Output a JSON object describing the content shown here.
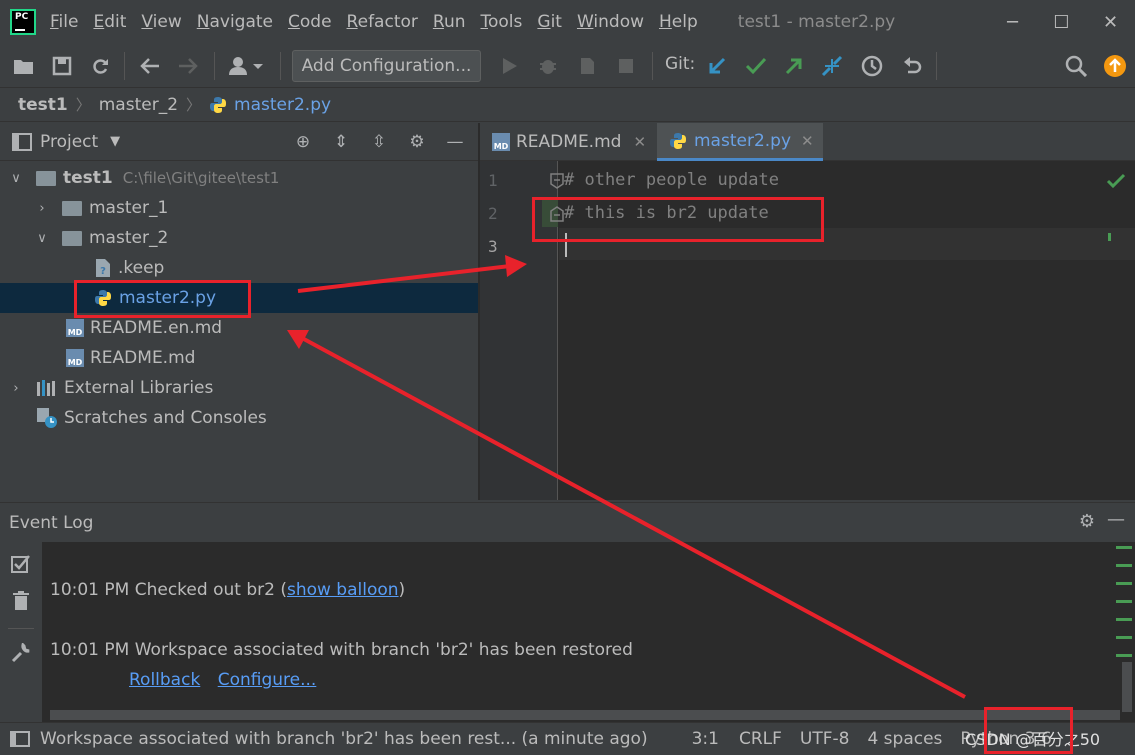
{
  "app": {
    "logo_text": "PC",
    "window_title": "test1 - master2.py"
  },
  "menu": [
    {
      "first": "F",
      "rest": "ile"
    },
    {
      "first": "E",
      "rest": "dit"
    },
    {
      "first": "V",
      "rest": "iew"
    },
    {
      "first": "N",
      "rest": "avigate"
    },
    {
      "first": "C",
      "rest": "ode"
    },
    {
      "first": "R",
      "rest": "efactor"
    },
    {
      "first": "R",
      "rest": "un"
    },
    {
      "first": "T",
      "rest": "ools"
    },
    {
      "first": "G",
      "rest": "it"
    },
    {
      "first": "W",
      "rest": "indow"
    },
    {
      "first": "H",
      "rest": "elp"
    }
  ],
  "toolbar": {
    "add_configuration": "Add Configuration...",
    "git_label": "Git:"
  },
  "breadcrumb": [
    "test1",
    "master_2",
    "master2.py"
  ],
  "project_panel": {
    "title": "Project"
  },
  "tree": {
    "root_name": "test1",
    "root_path": "C:\\file\\Git\\gitee\\test1",
    "master_1": "master_1",
    "master_2": "master_2",
    "keep": ".keep",
    "master2_py": "master2.py",
    "readme_en": "README.en.md",
    "readme": "README.md",
    "external_libs": "External Libraries",
    "scratches": "Scratches and Consoles",
    "md_badge": "MD"
  },
  "editor_tabs": [
    {
      "label": "README.md"
    },
    {
      "label": "master2.py"
    }
  ],
  "editor": {
    "line_numbers": [
      "1",
      "2",
      "3"
    ],
    "lines": [
      "# other people update",
      "# this is br2 update",
      ""
    ]
  },
  "event_log": {
    "title": "Event Log",
    "entry1": {
      "time": "10:01 PM",
      "text": "Checked out br2 (",
      "link": "show balloon",
      "tail": ")"
    },
    "entry2": {
      "time": "10:01 PM",
      "text": "Workspace associated with branch 'br2' has been restored"
    },
    "links": [
      "Rollback",
      "Configure..."
    ]
  },
  "status_bar": {
    "message": "Workspace associated with branch 'br2' has been rest... (a minute ago)",
    "position": "3:1",
    "line_sep": "CRLF",
    "encoding": "UTF-8",
    "indent": "4 spaces",
    "interpreter": "Python 3.6",
    "watermark": "CSDN @百分之50"
  },
  "colors": {
    "accent": "#4a88c7",
    "selection": "#0d293e",
    "annotation": "#e8222b",
    "git_check": "#499c54"
  }
}
